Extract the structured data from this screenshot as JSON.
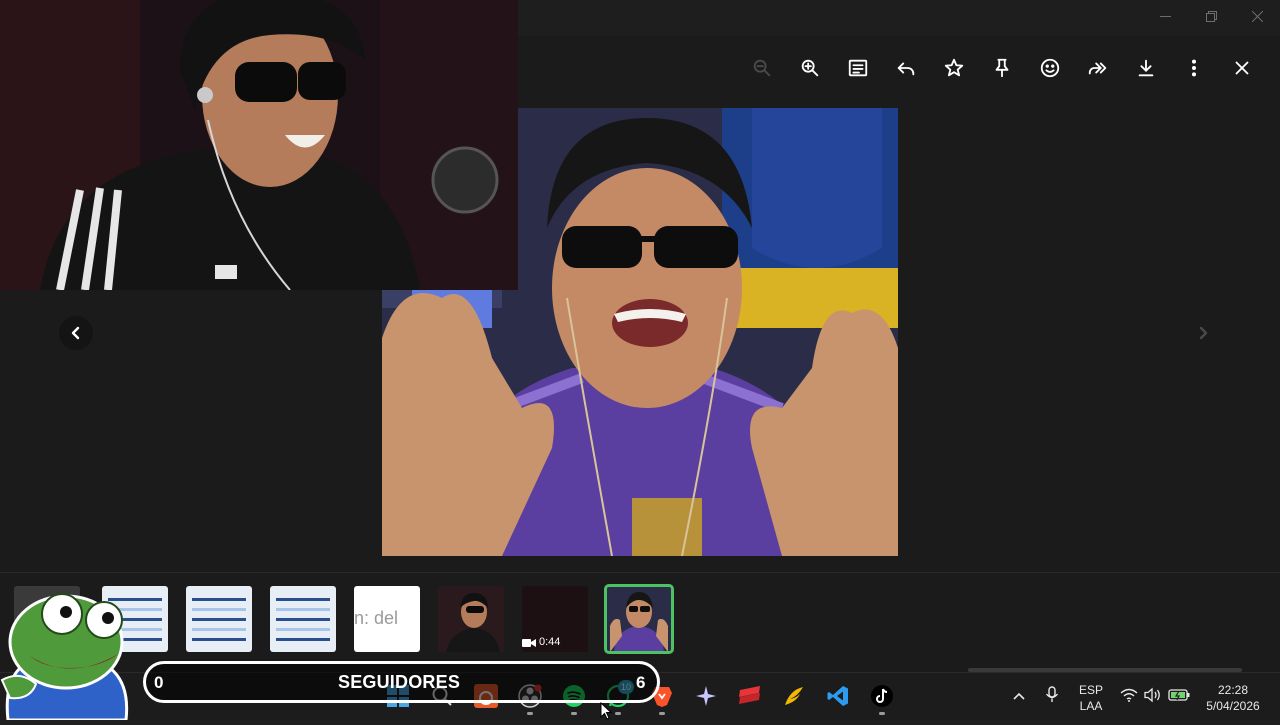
{
  "window": {
    "controls": [
      "minimize",
      "maximize",
      "close"
    ]
  },
  "toolbar": {
    "tools": [
      {
        "name": "zoom-out-icon",
        "enabled": false
      },
      {
        "name": "zoom-in-icon",
        "enabled": true
      },
      {
        "name": "caption-icon",
        "enabled": true
      },
      {
        "name": "reply-icon",
        "enabled": true
      },
      {
        "name": "star-icon",
        "enabled": true
      },
      {
        "name": "pin-icon",
        "enabled": true
      },
      {
        "name": "emoji-icon",
        "enabled": true
      },
      {
        "name": "forward-icon",
        "enabled": true
      },
      {
        "name": "download-icon",
        "enabled": true
      },
      {
        "name": "more-icon",
        "enabled": true
      },
      {
        "name": "close-icon",
        "enabled": true
      }
    ]
  },
  "thumbnails": {
    "text_thumb": "n: del",
    "video_duration": "0:44",
    "selected_index": 7
  },
  "overlay": {
    "count": "0",
    "label": "SEGUIDORES",
    "goal": "6"
  },
  "taskbar": {
    "whatsapp_badge": "10",
    "language": "ESP",
    "layout": "LAA",
    "time": "22:28",
    "date": "5/04/2026",
    "accent": "#4cc262"
  }
}
